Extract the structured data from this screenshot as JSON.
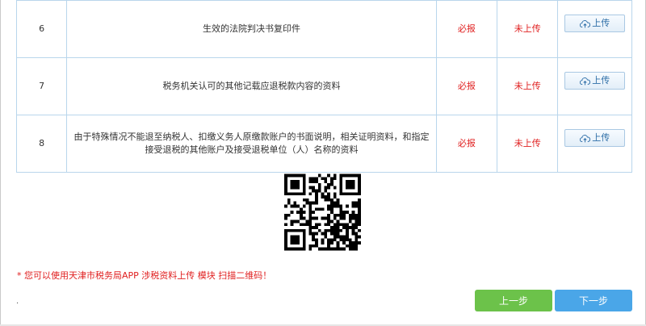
{
  "rows": [
    {
      "num": "6",
      "name": "生效的法院判决书复印件",
      "required": "必报",
      "status": "未上传",
      "action": "上传"
    },
    {
      "num": "7",
      "name": "税务机关认可的其他记载应退税款内容的资料",
      "required": "必报",
      "status": "未上传",
      "action": "上传"
    },
    {
      "num": "8",
      "name": "由于特殊情况不能退至纳税人、扣缴义务人原缴款账户的书面说明，相关证明资料，和指定接受退税的其他账户及接受退税单位（人）名称的资料",
      "required": "必报",
      "status": "未上传",
      "action": "上传"
    }
  ],
  "upload_icon": "cloud-upload-icon",
  "notice": "* 您可以使用天津市税务局APP 涉税资料上传 模块 扫描二维码！",
  "footnote": ".",
  "buttons": {
    "prev": "上一步",
    "next": "下一步"
  },
  "colors": {
    "prev": "#6cc24a",
    "next": "#4aa6e8",
    "required": "#e02020",
    "status": "#e02020",
    "border": "#b9d6ec"
  }
}
